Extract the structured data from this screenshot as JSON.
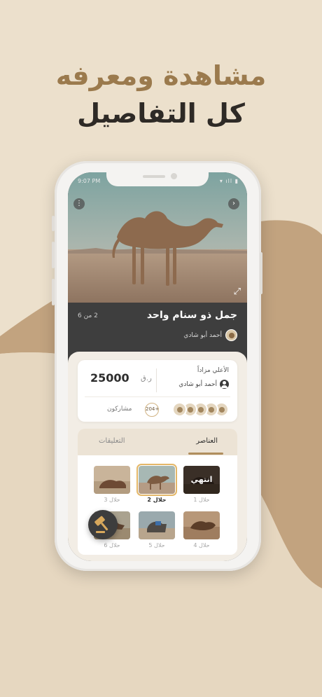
{
  "promo": {
    "headline_line1": "مشاهدة ومعرفه",
    "headline_line2": "كل التفاصيل"
  },
  "status_bar": {
    "time": "9:07 PM"
  },
  "item": {
    "title": "جمل ذو سنام واحد",
    "counter": "2 من 6",
    "seller_name": "أحمد أبو شادي"
  },
  "bid": {
    "label": "الأعلي مزاداً",
    "bidder_name": "أحمد أبو شادي",
    "amount": "25000",
    "currency": "ر.ق",
    "participants_count": "204+",
    "participants_label": "مشاركون"
  },
  "tabs": {
    "items_label": "العناصر",
    "comments_label": "التعليقات",
    "active": "items"
  },
  "grid_items": [
    {
      "label": "حلال 1",
      "overlay": "انتهي"
    },
    {
      "label": "حلال 2",
      "selected": true
    },
    {
      "label": "حلال 3"
    },
    {
      "label": "حلال 4"
    },
    {
      "label": "حلال 5"
    },
    {
      "label": "حلال 6"
    }
  ],
  "icons": {
    "menu": "more-vertical-icon",
    "back": "chevron-right-icon",
    "expand": "expand-icon",
    "bidder": "user-icon",
    "fab": "gavel-icon"
  },
  "colors": {
    "background": "#ece0cc",
    "accent_gold": "#9b7a4d",
    "underline": "#b08e5e",
    "dark": "#3e3e3e"
  }
}
